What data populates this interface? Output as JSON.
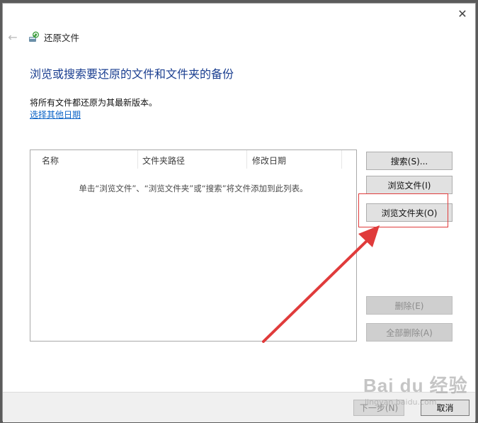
{
  "window": {
    "title": "还原文件",
    "close_glyph": "✕",
    "back_glyph": "←"
  },
  "content": {
    "heading": "浏览或搜索要还原的文件和文件夹的备份",
    "description": "将所有文件都还原为其最新版本。",
    "choose_date_link": "选择其他日期"
  },
  "file_list": {
    "columns": [
      "名称",
      "文件夹路径",
      "修改日期"
    ],
    "empty_message": "单击“浏览文件”、“浏览文件夹”或“搜索”将文件添加到此列表。"
  },
  "buttons": {
    "search": "搜索(S)...",
    "browse_files": "浏览文件(I)",
    "browse_folders": "浏览文件夹(O)",
    "delete": "删除(E)",
    "delete_all": "全部删除(A)"
  },
  "footer": {
    "next": "下一步(N)",
    "cancel": "取消"
  },
  "watermark": {
    "logo": "Bai du 经验",
    "site": "jingyan.baidu.com"
  },
  "colors": {
    "heading": "#1a3e90",
    "link": "#0b63c6",
    "annotation_red": "#e03b3b"
  },
  "icons": {
    "app": "restore-files-icon",
    "back": "back-arrow-icon",
    "close": "close-icon"
  }
}
